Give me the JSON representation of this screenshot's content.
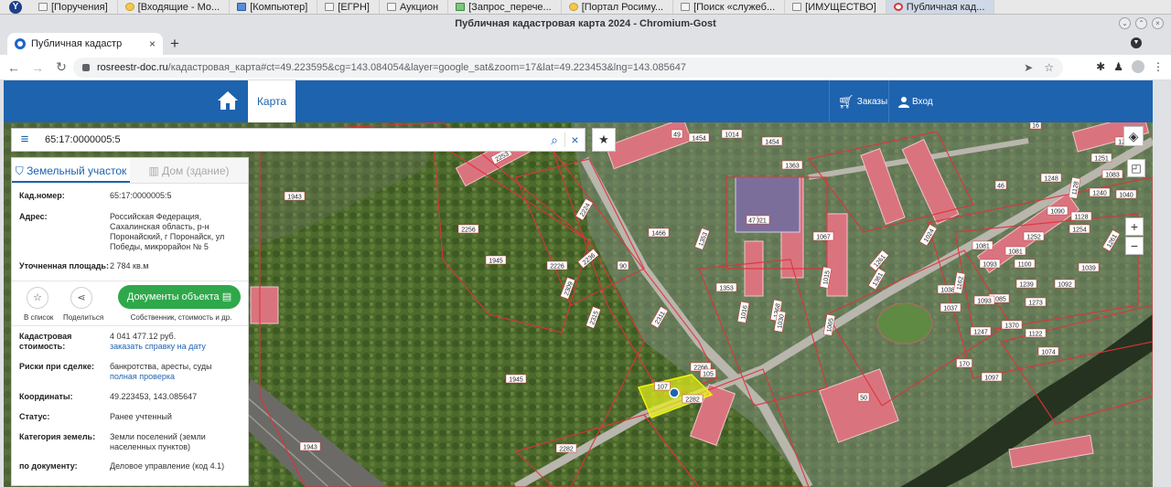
{
  "taskbar": {
    "items": [
      {
        "label": "[Поручения]",
        "icon": "folder-icon"
      },
      {
        "label": "[Входящие - Мо...",
        "icon": "mail-icon"
      },
      {
        "label": "[Компьютер]",
        "icon": "computer-icon"
      },
      {
        "label": "[ЕГРН]",
        "icon": "folder-icon"
      },
      {
        "label": "Аукцион",
        "icon": "folder-icon"
      },
      {
        "label": "[Запрос_перече...",
        "icon": "sheet-icon"
      },
      {
        "label": "[Портал Росиму...",
        "icon": "browser-icon"
      },
      {
        "label": "[Поиск «служеб...",
        "icon": "doc-icon"
      },
      {
        "label": "[ИМУЩЕСТВО]",
        "icon": "folder-icon"
      },
      {
        "label": "Публичная кад...",
        "icon": "chromium-icon"
      }
    ]
  },
  "window": {
    "title": "Публичная кадастровая карта 2024 - Chromium-Gost"
  },
  "tab": {
    "label": "Публичная кадастр",
    "close": "×",
    "new": "+"
  },
  "address": {
    "host": "rosreestr-doc.ru",
    "path": "/кадастровая_карта#ct=49.223595&cg=143.084054&layer=google_sat&zoom=17&lat=49.223453&lng=143.085647"
  },
  "header": {
    "map_tab": "Карта",
    "orders": "Заказы",
    "login": "Вход",
    "accent": "#1e63ae"
  },
  "search": {
    "value": "65:17:0000005:5"
  },
  "panel": {
    "tab_land": "Земельный участок",
    "tab_house": "Дом (здание)",
    "cadnum_label": "Кад.номер:",
    "cadnum_value": "65:17:0000005:5",
    "address_label": "Адрес:",
    "address_value": "Российская Федерация, Сахалинская область, р-н Поронайский, г Поронайск, ул Победы, микрорайон № 5",
    "area_label": "Уточненная площадь:",
    "area_value": "2 784 кв.м",
    "add_to_list": "В список",
    "share": "Поделиться",
    "docs_button": "Документы объекта",
    "docs_sub": "Собственник, стоимость и др.",
    "cost_label": "Кадастровая стоимость:",
    "cost_value": "4 041 477.12 руб.",
    "cost_link": "заказать справку на дату",
    "risk_label": "Риски при сделке:",
    "risk_value": "банкротства, аресты, суды",
    "risk_link": "полная проверка",
    "coords_label": "Координаты:",
    "coords_value": "49.223453, 143.085647",
    "status_label": "Статус:",
    "status_value": "Ранее учтенный",
    "category_label": "Категория земель:",
    "category_value": "Земли поселений (земли населенных пунктов)",
    "doc_label": "по документу:",
    "doc_value": "Деловое управление (код 4.1)"
  },
  "map_labels": [
    "2253",
    "2256",
    "1945",
    "1943",
    "1945",
    "2266",
    "2282",
    "1943",
    "2282",
    "1466",
    "1353",
    "1353",
    "1368",
    "1361",
    "1363",
    "1259",
    "1240",
    "1248",
    "1081",
    "1093",
    "1100",
    "1239",
    "1273",
    "1370",
    "1247",
    "1037",
    "1038",
    "1074",
    "1015",
    "1454",
    "1454",
    "1067",
    "1261",
    "1128",
    "1040",
    "1083",
    "1251",
    "2226",
    "2236",
    "2309",
    "2315",
    "2311",
    "2224",
    "1090",
    "1085",
    "1162",
    "1092",
    "1081",
    "1039",
    "1252",
    "1254",
    "1093",
    "1128",
    "1261",
    "1122",
    "1016",
    "1030",
    "1024",
    "1065",
    "1021",
    "1014",
    "1097",
    "49",
    "47",
    "50",
    "90",
    "105",
    "107",
    "170",
    "16",
    "46"
  ]
}
